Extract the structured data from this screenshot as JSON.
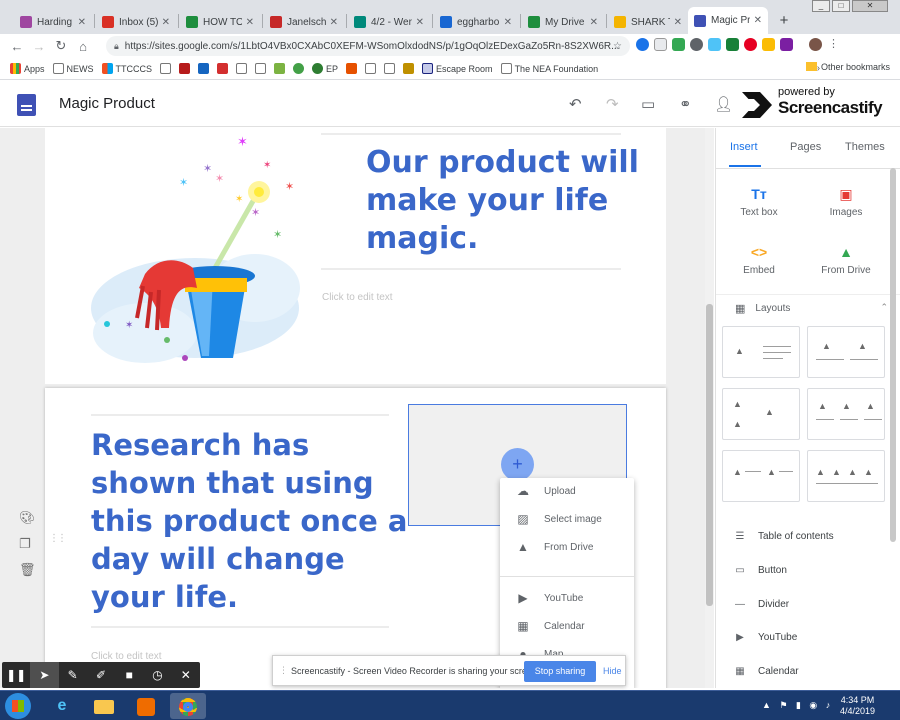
{
  "browser": {
    "tabs": [
      {
        "title": "Harding T",
        "color": "#9f46a0"
      },
      {
        "title": "Inbox (5)",
        "color": "#d93025"
      },
      {
        "title": "HOW TO",
        "color": "#1e8e3e"
      },
      {
        "title": "Janelschak",
        "color": "#c62828"
      },
      {
        "title": "4/2 - Wer",
        "color": "#00897b"
      },
      {
        "title": "eggharbo",
        "color": "#1967d2"
      },
      {
        "title": "My Drive",
        "color": "#1e8e3e"
      },
      {
        "title": "SHARK TA",
        "color": "#f4b400"
      },
      {
        "title": "Magic Pro",
        "color": "#3f51b5"
      }
    ],
    "url": "https://sites.google.com/s/1LbtO4VBx0CXAbC0XEFM-WSomOlxdodNS/p/1gOqOlzEDexGaZo5Rn-8S2XW6R...",
    "bookmarks": [
      "Apps",
      "NEWS",
      "TTCCCS",
      "EP",
      "Escape Room",
      "The NEA Foundation"
    ],
    "bookmarks_more": "»",
    "other_bookmarks": "Other bookmarks"
  },
  "sites": {
    "site_title": "Magic Product",
    "powered_by": "powered by",
    "brand": "Screencastify"
  },
  "content": {
    "headline1": "Our product will make your life magic.",
    "placeholder1": "Click to edit text",
    "headline2": "Research has shown that using this product once a day will change your life.",
    "placeholder2": "Click to edit text",
    "add_button": "+",
    "image_menu": [
      "Upload",
      "Select image",
      "From Drive",
      "YouTube",
      "Calendar",
      "Map"
    ]
  },
  "panel": {
    "tabs": [
      "Insert",
      "Pages",
      "Themes"
    ],
    "insert_items": [
      {
        "label": "Text box",
        "glyph": "Tт"
      },
      {
        "label": "Images",
        "glyph": "▣"
      },
      {
        "label": "Embed",
        "glyph": "<>"
      },
      {
        "label": "From Drive",
        "glyph": "▲"
      }
    ],
    "layouts_label": "Layouts",
    "layouts_collapse": "⌃",
    "list_items": [
      "Table of contents",
      "Button",
      "Divider",
      "YouTube",
      "Calendar"
    ]
  },
  "screencastify_bar": {
    "message": "Screencastify - Screen Video Recorder is sharing your screen.",
    "stop_label": "Stop sharing",
    "hide_label": "Hide"
  },
  "taskbar": {
    "time": "4:34 PM",
    "date": "4/4/2019"
  },
  "colors": {
    "accent": "#1a73e8",
    "headline": "#3a67c9",
    "stop_button": "#4a86e8"
  }
}
